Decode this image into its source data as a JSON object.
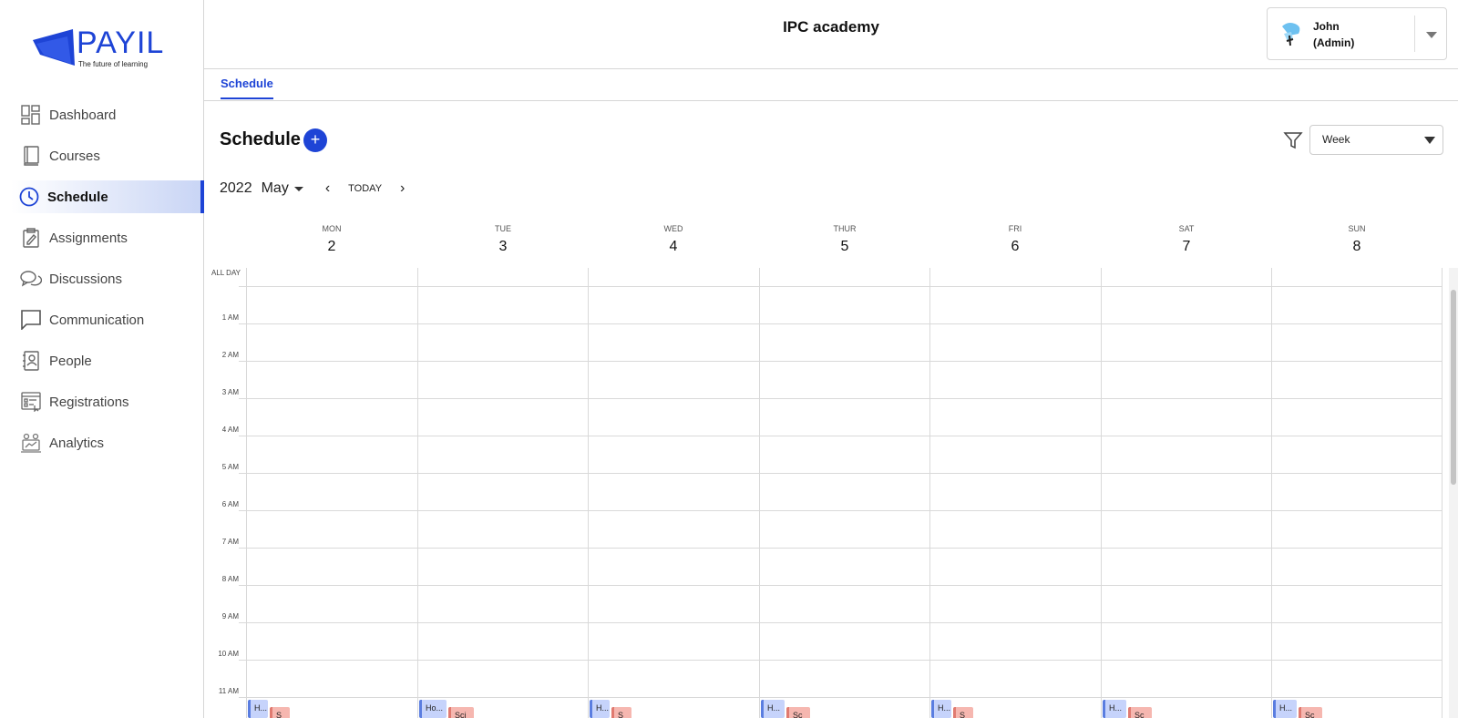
{
  "app": {
    "logo_text": "PAYIL",
    "tagline": "The future of learning"
  },
  "sidebar": {
    "items": [
      {
        "label": "Dashboard",
        "icon": "dashboard-icon"
      },
      {
        "label": "Courses",
        "icon": "book-icon"
      },
      {
        "label": "Schedule",
        "icon": "clock-icon",
        "active": true
      },
      {
        "label": "Assignments",
        "icon": "clipboard-icon"
      },
      {
        "label": "Discussions",
        "icon": "chat-bubbles-icon"
      },
      {
        "label": "Communication",
        "icon": "message-icon"
      },
      {
        "label": "People",
        "icon": "contacts-icon"
      },
      {
        "label": "Registrations",
        "icon": "registration-form-icon"
      },
      {
        "label": "Analytics",
        "icon": "analytics-icon"
      }
    ]
  },
  "header": {
    "org_name": "IPC academy",
    "user_name": "John",
    "user_role": "(Admin)"
  },
  "tabs": [
    {
      "label": "Schedule",
      "active": true
    }
  ],
  "schedule": {
    "title": "Schedule",
    "add_symbol": "+",
    "view_option": "Week",
    "year": "2022",
    "month": "May",
    "today_label": "TODAY",
    "prev_symbol": "‹",
    "next_symbol": "›"
  },
  "calendar": {
    "days": [
      {
        "dow": "MON",
        "num": "2"
      },
      {
        "dow": "TUE",
        "num": "3"
      },
      {
        "dow": "WED",
        "num": "4"
      },
      {
        "dow": "THUR",
        "num": "5"
      },
      {
        "dow": "FRI",
        "num": "6"
      },
      {
        "dow": "SAT",
        "num": "7"
      },
      {
        "dow": "SUN",
        "num": "8"
      }
    ],
    "all_day_label": "ALL DAY",
    "hours": [
      "1 AM",
      "2 AM",
      "3 AM",
      "4 AM",
      "5 AM",
      "6 AM",
      "7 AM",
      "8 AM",
      "9 AM",
      "10 AM",
      "11 AM"
    ],
    "events": [
      {
        "blue": "H...",
        "red": "S"
      },
      {
        "blue": "Ho...",
        "red": "Sci"
      },
      {
        "blue": "H...",
        "red": "S"
      },
      {
        "blue": "H...",
        "red": "Sc"
      },
      {
        "blue": "H...",
        "red": "S"
      },
      {
        "blue": "H...",
        "red": "Sc"
      },
      {
        "blue": "H...",
        "red": "Sc"
      }
    ],
    "colors": {
      "event_blue": "#c6d3fb",
      "event_red": "#f6b7b0",
      "accent": "#1e44d6"
    }
  }
}
